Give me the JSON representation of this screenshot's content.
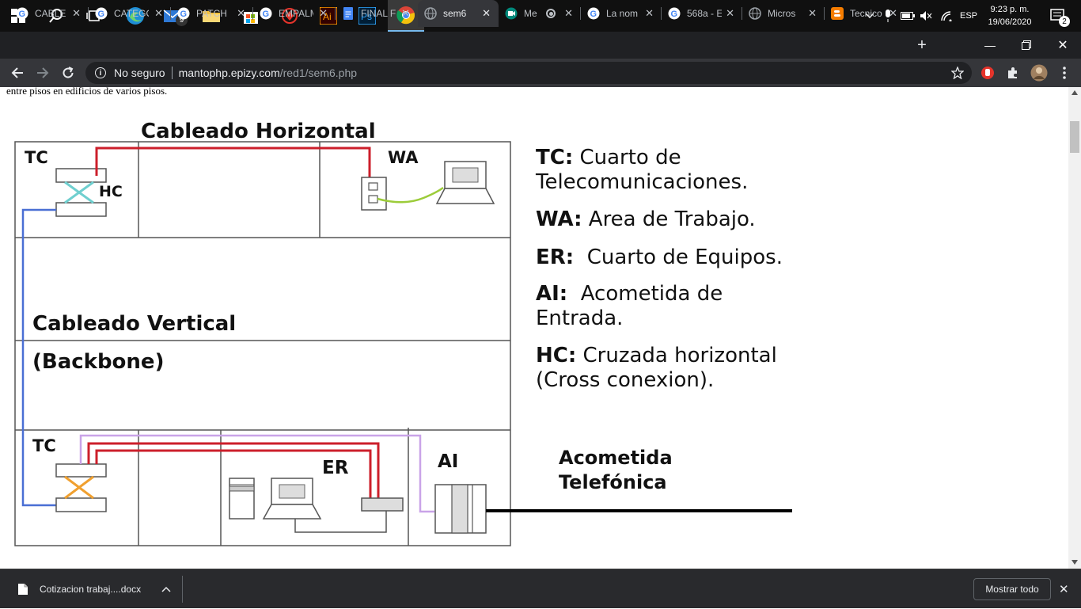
{
  "taskbar": {
    "mail_badge": "9",
    "tray": {
      "lang": "ESP",
      "time": "9:23 p. m.",
      "date": "19/06/2020",
      "notif_count": "2"
    }
  },
  "tabs": [
    {
      "title": "CABLE",
      "favicon": "google"
    },
    {
      "title": "CATEGO",
      "favicon": "google"
    },
    {
      "title": "PATCH",
      "favicon": "google"
    },
    {
      "title": "EMPALM",
      "favicon": "google"
    },
    {
      "title": "FINAL F",
      "favicon": "docs"
    },
    {
      "title": "sem6",
      "favicon": "globe"
    },
    {
      "title": "Me",
      "favicon": "meet"
    },
    {
      "title": "La nom",
      "favicon": "google"
    },
    {
      "title": "568a - E",
      "favicon": "google"
    },
    {
      "title": "Micros",
      "favicon": "globe"
    },
    {
      "title": "Tecnico",
      "favicon": "blogger"
    }
  ],
  "address": {
    "security": "No seguro",
    "host": "mantophp.epizy.com",
    "path": "/red1/sem6.php"
  },
  "page": {
    "top_text": "entre pisos en edificios de varios pisos.",
    "diagram": {
      "title": "Cableado Horizontal",
      "tc_top": "TC",
      "hc": "HC",
      "wa": "WA",
      "vertical_1": "Cableado Vertical",
      "vertical_2": "(Backbone)",
      "tc_bottom": "TC",
      "er": "ER",
      "ai": "AI",
      "acometida_1": "Acometida",
      "acometida_2": "Telefónica"
    },
    "legend": [
      {
        "abbr": "TC:",
        "line1": " Cuarto de",
        "line2": "Telecomunicaciones."
      },
      {
        "abbr": "WA:",
        "line1": " Area de Trabajo.",
        "line2": ""
      },
      {
        "abbr": "ER:",
        "line1": "  Cuarto de Equipos.",
        "line2": ""
      },
      {
        "abbr": "AI:",
        "line1": "  Acometida de",
        "line2": "Entrada."
      },
      {
        "abbr": "HC:",
        "line1": " Cruzada horizontal",
        "line2": "(Cross conexion)."
      }
    ]
  },
  "downloads": {
    "file": "Cotizacion trabaj....docx",
    "show_all": "Mostrar todo"
  }
}
